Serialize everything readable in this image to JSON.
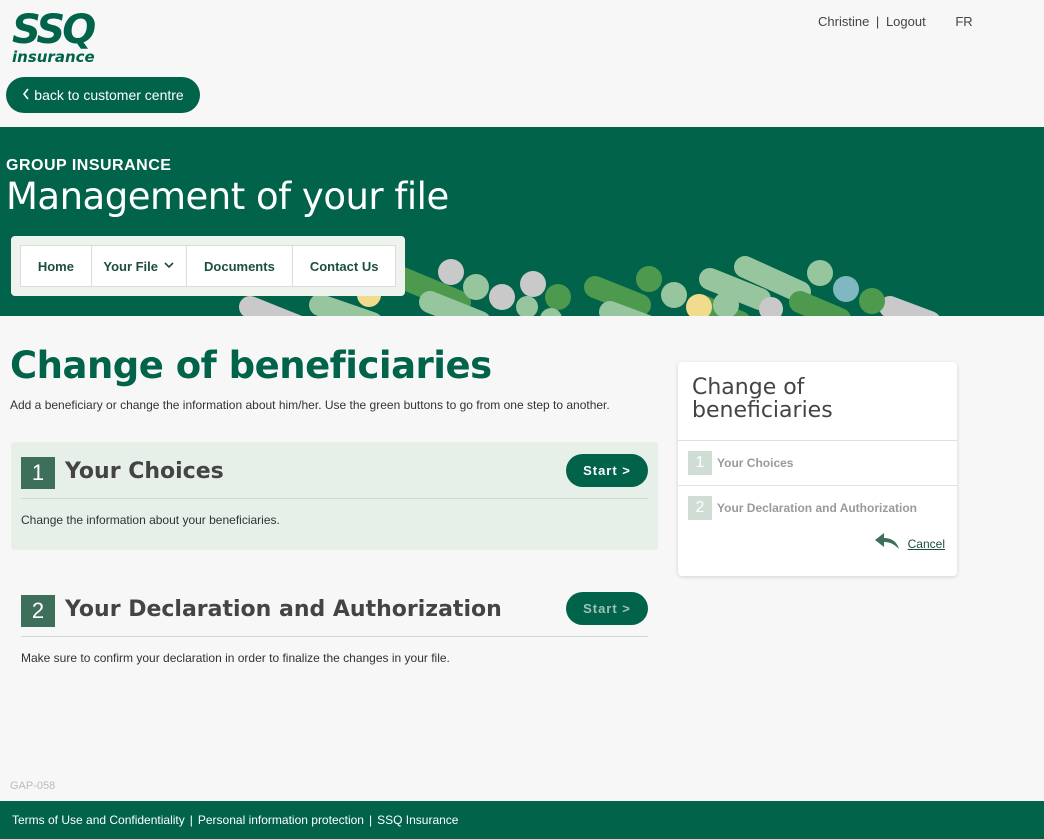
{
  "header": {
    "logo_main": "SSQ",
    "logo_sub": "insurance",
    "user_name": "Christine",
    "separator": "|",
    "logout_label": "Logout",
    "language_label": "FR",
    "back_label": "back to customer centre"
  },
  "banner": {
    "kicker": "GROUP INSURANCE",
    "title": "Management of your file"
  },
  "nav": {
    "items": [
      {
        "label": "Home"
      },
      {
        "label": "Your File"
      },
      {
        "label": "Documents"
      },
      {
        "label": "Contact Us"
      }
    ]
  },
  "main": {
    "heading": "Change of beneficiaries",
    "intro": "Add a beneficiary or change the information about him/her. Use the green buttons to go from one step to another.",
    "steps": [
      {
        "number": "1",
        "title": "Your Choices",
        "description": "Change the information about your beneficiaries.",
        "button": "Start >"
      },
      {
        "number": "2",
        "title": "Your Declaration and Authorization",
        "description": "Make sure to confirm your declaration in order to finalize the changes in your file.",
        "button": "Start >"
      }
    ]
  },
  "sidebar": {
    "title": "Change of beneficiaries",
    "items": [
      {
        "number": "1",
        "label": "Your Choices"
      },
      {
        "number": "2",
        "label": "Your Declaration and Authorization"
      }
    ],
    "cancel_label": "Cancel"
  },
  "page_code": "GAP-058",
  "footer": {
    "links": [
      {
        "label": "Terms of Use and Confidentiality"
      },
      {
        "label": "Personal information protection"
      },
      {
        "label": "SSQ Insurance"
      }
    ],
    "separator": "|"
  },
  "colors": {
    "brand_green": "#00634a",
    "light_green_panel": "#e6efe8",
    "step_number_bg": "#3d6f5a",
    "sidebar_number_bg": "#cfddd5"
  }
}
